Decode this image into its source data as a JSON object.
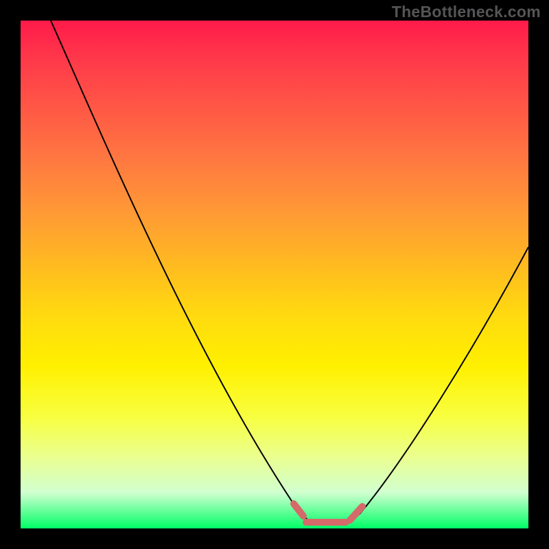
{
  "watermark": "TheBottleneck.com",
  "colors": {
    "curve": "#000000",
    "flat_overlay": "#d46a6a",
    "background_black": "#000000"
  },
  "chart_data": {
    "type": "line",
    "title": "",
    "xlabel": "",
    "ylabel": "",
    "xlim": [
      0,
      100
    ],
    "ylim": [
      0,
      100
    ],
    "grid": false,
    "legend": false,
    "series": [
      {
        "name": "bottleneck-curve",
        "x": [
          0,
          5,
          10,
          15,
          20,
          25,
          30,
          35,
          40,
          45,
          50,
          55,
          57,
          60,
          63,
          66,
          70,
          75,
          80,
          85,
          90,
          95,
          100
        ],
        "y": [
          100,
          92,
          84,
          76,
          68,
          60,
          52,
          44,
          35,
          26,
          17,
          8,
          3,
          1,
          1,
          1,
          3,
          10,
          19,
          28,
          37,
          47,
          56
        ]
      }
    ],
    "annotations": [
      {
        "name": "flat-region-highlight",
        "x_start": 54,
        "x_end": 70,
        "y": 1,
        "color": "#d46a6a"
      }
    ],
    "gradient_stops": [
      {
        "pos": 0,
        "color": "#ff1a4a"
      },
      {
        "pos": 50,
        "color": "#ffda10"
      },
      {
        "pos": 100,
        "color": "#00ff66"
      }
    ]
  }
}
